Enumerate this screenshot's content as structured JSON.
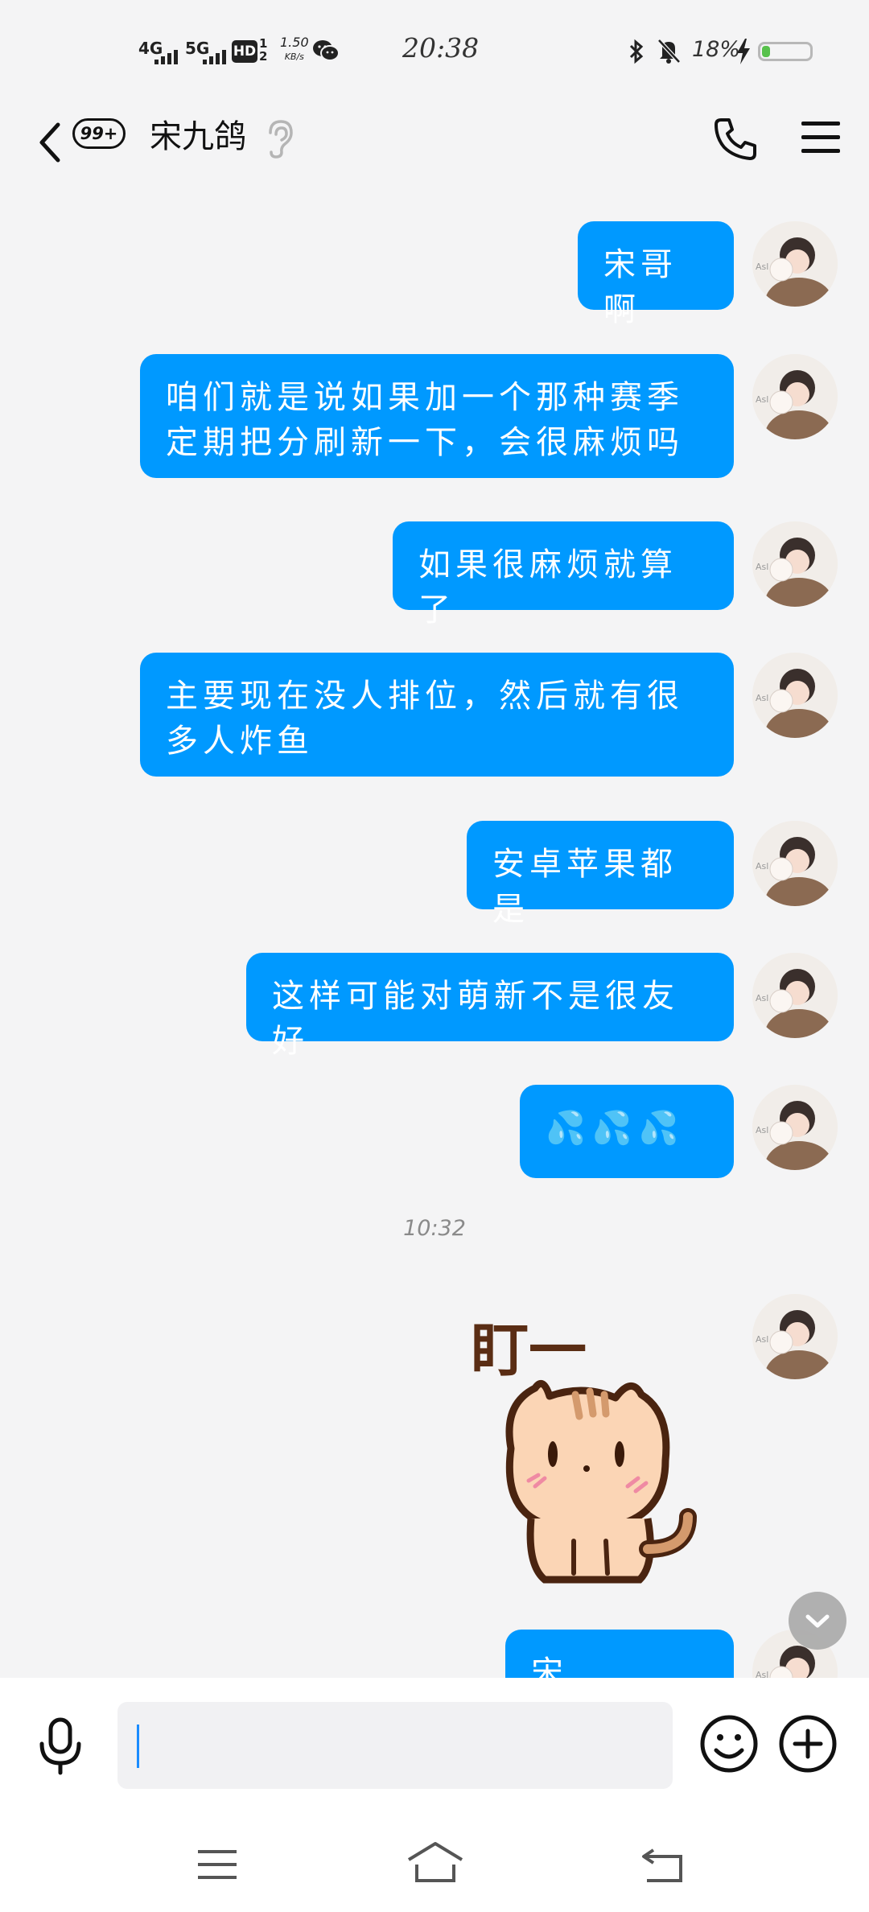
{
  "status_bar": {
    "network_1": "4G",
    "network_2": "5G",
    "hd_label": "HD",
    "sim": "1\n2",
    "speed_value": "1.50",
    "speed_unit": "KB/s",
    "time": "20:38",
    "battery_percent": "18%",
    "battery_level": 0.18,
    "icons": [
      "signal-icon",
      "wechat-icon",
      "bluetooth-icon",
      "mute-icon",
      "charging-icon",
      "battery-icon"
    ]
  },
  "header": {
    "unread_count": "99+",
    "contact_name": "宋九鸽",
    "icons": [
      "back-icon",
      "ear-icon",
      "call-icon",
      "menu-icon"
    ]
  },
  "messages": [
    {
      "type": "text",
      "text": "宋哥啊"
    },
    {
      "type": "text",
      "text": "咱们就是说如果加一个那种赛季\n定期把分刷新一下，会很麻烦吗"
    },
    {
      "type": "text",
      "text": "如果很麻烦就算了"
    },
    {
      "type": "text",
      "text": "主要现在没人排位，然后就有很\n多人炸鱼"
    },
    {
      "type": "text",
      "text": "安卓苹果都是"
    },
    {
      "type": "text",
      "text": "这样可能对萌新不是很友好"
    },
    {
      "type": "text",
      "text": "💦💦💦"
    },
    {
      "type": "timestamp",
      "text": "10:32"
    },
    {
      "type": "sticker",
      "text": "盯一"
    },
    {
      "type": "text",
      "text": "宋哥！！！"
    }
  ],
  "input": {
    "value": "",
    "placeholder": "",
    "icons": [
      "mic-icon",
      "emoji-icon",
      "plus-icon"
    ]
  },
  "nav_bar": {
    "icons": [
      "nav-menu-icon",
      "nav-home-icon",
      "nav-back-icon"
    ]
  },
  "colors": {
    "bubble": "#0099ff",
    "background": "#f4f4f5",
    "battery_fill": "#57c14b",
    "caret": "#1a8cff"
  }
}
